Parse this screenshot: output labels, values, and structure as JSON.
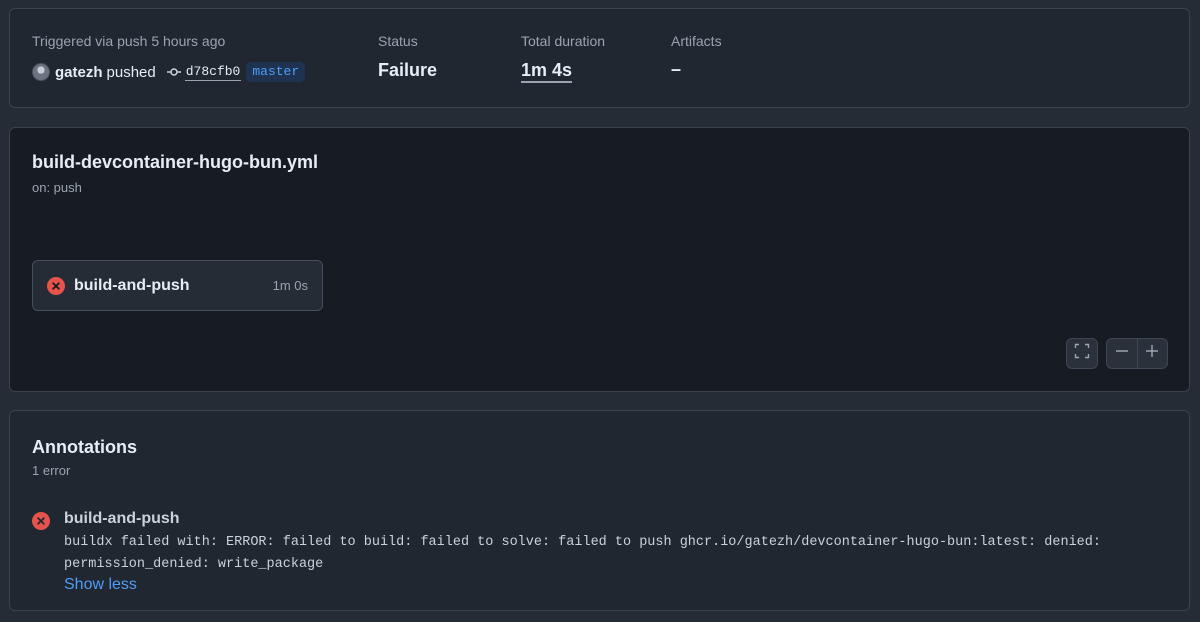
{
  "summary": {
    "trigger_label": "Triggered via push 5 hours ago",
    "user": "gatezh",
    "action": "pushed",
    "commit_sha": "d78cfb0",
    "branch": "master",
    "status_label": "Status",
    "status_value": "Failure",
    "duration_label": "Total duration",
    "duration_value": "1m 4s",
    "artifacts_label": "Artifacts",
    "artifacts_value": "–"
  },
  "workflow": {
    "file_name": "build-devcontainer-hugo-bun.yml",
    "trigger": "on: push",
    "job": {
      "name": "build-and-push",
      "duration": "1m 0s",
      "status": "failure",
      "status_icon": "x-circle-fill-icon"
    },
    "controls": {
      "fullscreen_icon": "fullscreen-icon",
      "zoom_out_icon": "minus-icon",
      "zoom_in_icon": "plus-icon"
    }
  },
  "annotations": {
    "title": "Annotations",
    "count": "1 error",
    "items": [
      {
        "job": "build-and-push",
        "icon": "x-circle-fill-icon",
        "message": "buildx failed with: ERROR: failed to build: failed to solve: failed to push ghcr.io/gatezh/devcontainer-hugo-bun:latest: denied:\npermission_denied: write_package",
        "toggle_label": "Show less"
      }
    ]
  },
  "colors": {
    "error": "#e5534b",
    "link": "#4f9cf9",
    "branch_bg": "#1f3350"
  }
}
